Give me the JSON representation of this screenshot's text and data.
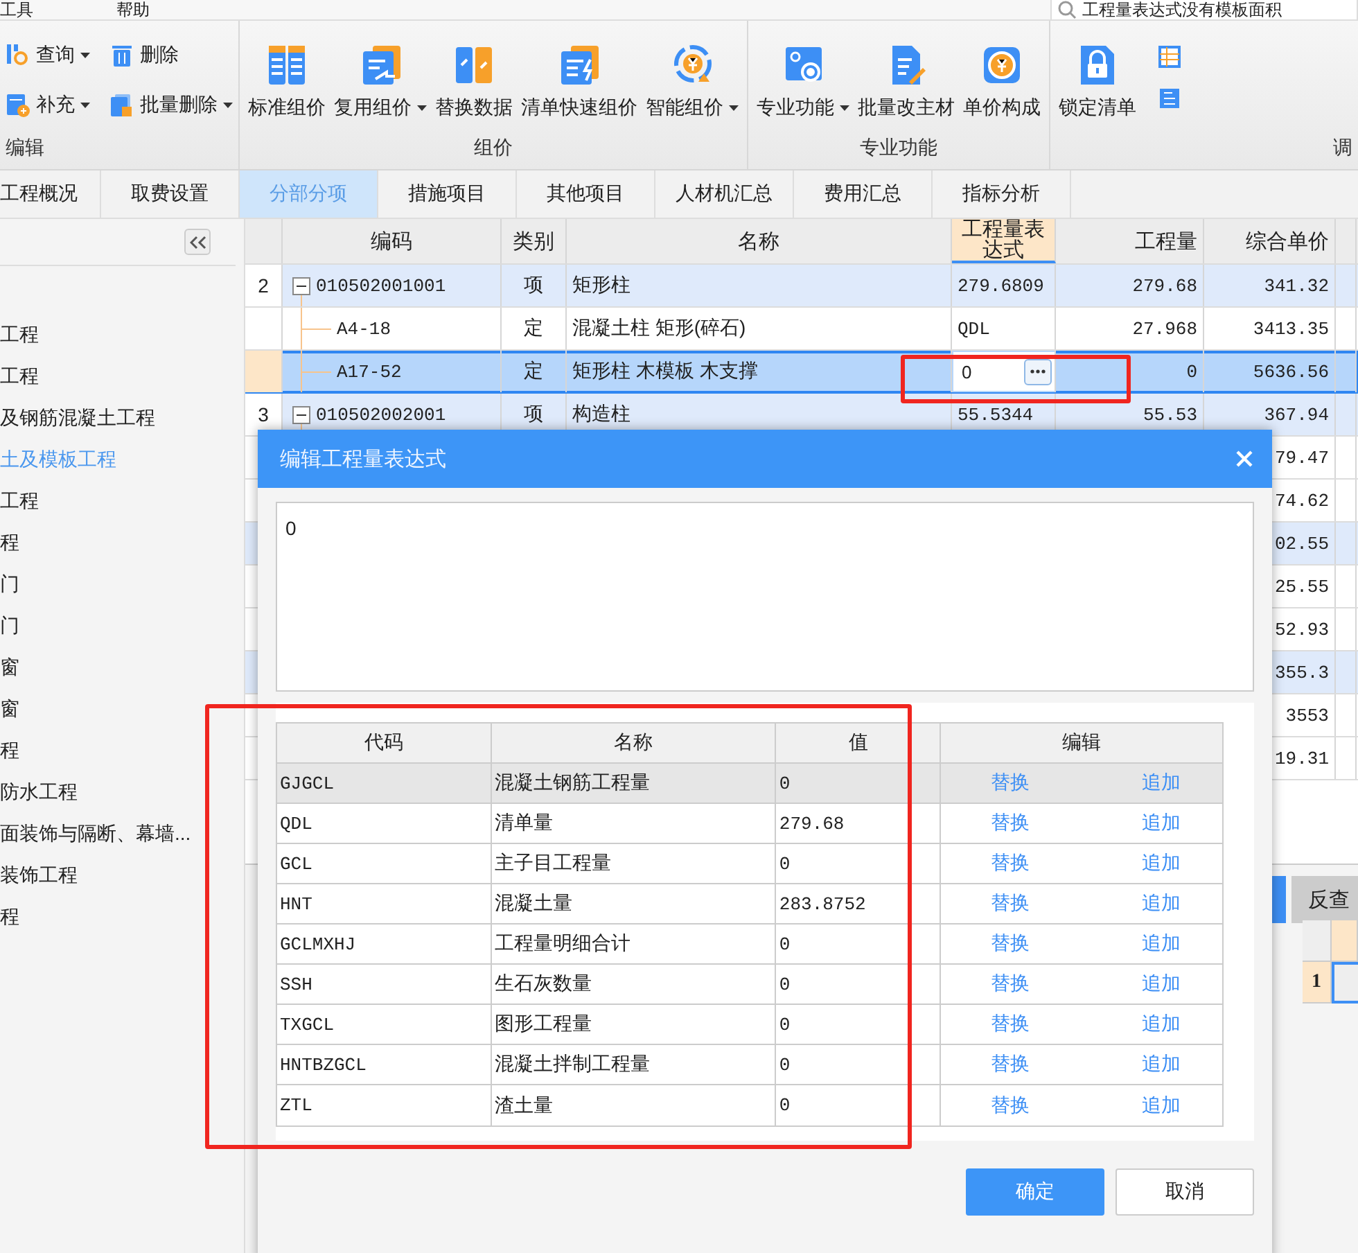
{
  "menu": [
    "工具",
    "帮助"
  ],
  "search": {
    "value": "工程量表达式没有模板面积"
  },
  "ribbon": [
    {
      "label": "编辑",
      "kind": "small",
      "buttons": [
        {
          "label": "查询",
          "dropdown": true
        },
        {
          "label": "删除",
          "dropdown": false
        },
        {
          "label": "补充",
          "dropdown": true
        },
        {
          "label": "批量删除",
          "dropdown": true
        }
      ]
    },
    {
      "label": "组价",
      "kind": "large",
      "buttons": [
        {
          "label": "标准组价",
          "dropdown": false
        },
        {
          "label": "复用组价",
          "dropdown": true
        },
        {
          "label": "替换数据",
          "dropdown": false
        },
        {
          "label": "清单快速组价",
          "dropdown": false
        },
        {
          "label": "智能组价",
          "dropdown": true
        }
      ]
    },
    {
      "label": "专业功能",
      "kind": "large",
      "buttons": [
        {
          "label": "专业功能",
          "dropdown": true
        },
        {
          "label": "批量改主材",
          "dropdown": false
        },
        {
          "label": "单价构成",
          "dropdown": false
        }
      ]
    },
    {
      "label": "调",
      "kind": "large",
      "buttons": [
        {
          "label": "锁定清单",
          "dropdown": false
        }
      ]
    }
  ],
  "tabs": [
    {
      "label": "工程概况",
      "selected": false
    },
    {
      "label": "取费设置",
      "selected": false
    },
    {
      "label": "分部分项",
      "selected": true
    },
    {
      "label": "措施项目",
      "selected": false
    },
    {
      "label": "其他项目",
      "selected": false
    },
    {
      "label": "人材机汇总",
      "selected": false
    },
    {
      "label": "费用汇总",
      "selected": false
    },
    {
      "label": "指标分析",
      "selected": false
    }
  ],
  "sidebar": {
    "items": [
      {
        "label": "工程",
        "selected": false
      },
      {
        "label": "工程",
        "selected": false
      },
      {
        "label": "及钢筋混凝土工程",
        "selected": false
      },
      {
        "label": "土及模板工程",
        "selected": true
      },
      {
        "label": "工程",
        "selected": false
      },
      {
        "label": "程",
        "selected": false
      },
      {
        "label": "门",
        "selected": false
      },
      {
        "label": "门",
        "selected": false
      },
      {
        "label": "窗",
        "selected": false
      },
      {
        "label": "窗",
        "selected": false
      },
      {
        "label": "程",
        "selected": false
      },
      {
        "label": "防水工程",
        "selected": false
      },
      {
        "label": "面装饰与隔断、幕墙...",
        "selected": false
      },
      {
        "label": "装饰工程",
        "selected": false
      },
      {
        "label": "程",
        "selected": false
      }
    ]
  },
  "grid": {
    "columns": [
      "编码",
      "类别",
      "名称",
      "工程量表达式",
      "工程量",
      "综合单价"
    ],
    "rows": [
      {
        "kind": "bill",
        "num": "2",
        "code": "010502001001",
        "expanded": true,
        "type": "项",
        "name": "矩形柱",
        "expr": "279.6809",
        "qty": "279.68",
        "price": "341.32",
        "selected": false
      },
      {
        "kind": "quota",
        "code": "A4-18",
        "type": "定",
        "name": "混凝土柱 矩形(碎石)",
        "expr": "QDL",
        "qty": "27.968",
        "price": "3413.35",
        "selected": false
      },
      {
        "kind": "quota",
        "code": "A17-52",
        "type": "定",
        "name": "矩形柱 木模板 木支撑",
        "expr": "0",
        "qty": "0",
        "price": "5636.56",
        "selected": true
      },
      {
        "kind": "bill",
        "num": "3",
        "code": "010502002001",
        "expanded": true,
        "type": "项",
        "name": "构造柱",
        "expr": "55.5344",
        "qty": "55.53",
        "price": "367.94",
        "selected": false
      },
      {
        "kind": "quota",
        "price": "79.47",
        "selected": false
      },
      {
        "kind": "quota",
        "price": "74.62",
        "selected": false
      },
      {
        "kind": "bill",
        "price": "02.55",
        "selected": false
      },
      {
        "kind": "quota",
        "price": "25.55",
        "selected": false
      },
      {
        "kind": "quota",
        "price": "52.93",
        "selected": false
      },
      {
        "kind": "bill",
        "price": "355.3",
        "selected": false
      },
      {
        "kind": "quota",
        "price": "3553",
        "selected": false
      },
      {
        "kind": "quota",
        "price": "19.31",
        "selected": false
      }
    ]
  },
  "bottom_panel": {
    "tabs": [
      {
        "label": "反查",
        "selected": false
      }
    ],
    "rows": [
      "1"
    ]
  },
  "dialog": {
    "title": "编辑工程量表达式",
    "expression": "0",
    "columns": [
      "代码",
      "名称",
      "值",
      "编辑"
    ],
    "rows": [
      {
        "code": "GJGCL",
        "name": "混凝土钢筋工程量",
        "value": "0",
        "selected": true,
        "actions": [
          "替换",
          "追加"
        ]
      },
      {
        "code": "QDL",
        "name": "清单量",
        "value": "279.68",
        "selected": false,
        "actions": [
          "替换",
          "追加"
        ]
      },
      {
        "code": "GCL",
        "name": "主子目工程量",
        "value": "0",
        "selected": false,
        "actions": [
          "替换",
          "追加"
        ]
      },
      {
        "code": "HNT",
        "name": "混凝土量",
        "value": "283.8752",
        "selected": false,
        "actions": [
          "替换",
          "追加"
        ]
      },
      {
        "code": "GCLMXHJ",
        "name": "工程量明细合计",
        "value": "0",
        "selected": false,
        "actions": [
          "替换",
          "追加"
        ]
      },
      {
        "code": "SSH",
        "name": "生石灰数量",
        "value": "0",
        "selected": false,
        "actions": [
          "替换",
          "追加"
        ]
      },
      {
        "code": "TXGCL",
        "name": "图形工程量",
        "value": "0",
        "selected": false,
        "actions": [
          "替换",
          "追加"
        ]
      },
      {
        "code": "HNTBZGCL",
        "name": "混凝土拌制工程量",
        "value": "0",
        "selected": false,
        "actions": [
          "替换",
          "追加"
        ]
      },
      {
        "code": "ZTL",
        "name": "渣土量",
        "value": "0",
        "selected": false,
        "actions": [
          "替换",
          "追加"
        ]
      }
    ],
    "buttons": [
      {
        "label": "确定",
        "kind": "primary"
      },
      {
        "label": "取消",
        "kind": "secondary"
      }
    ]
  },
  "annotations": {
    "expression_cell": true,
    "variable_table": true
  }
}
